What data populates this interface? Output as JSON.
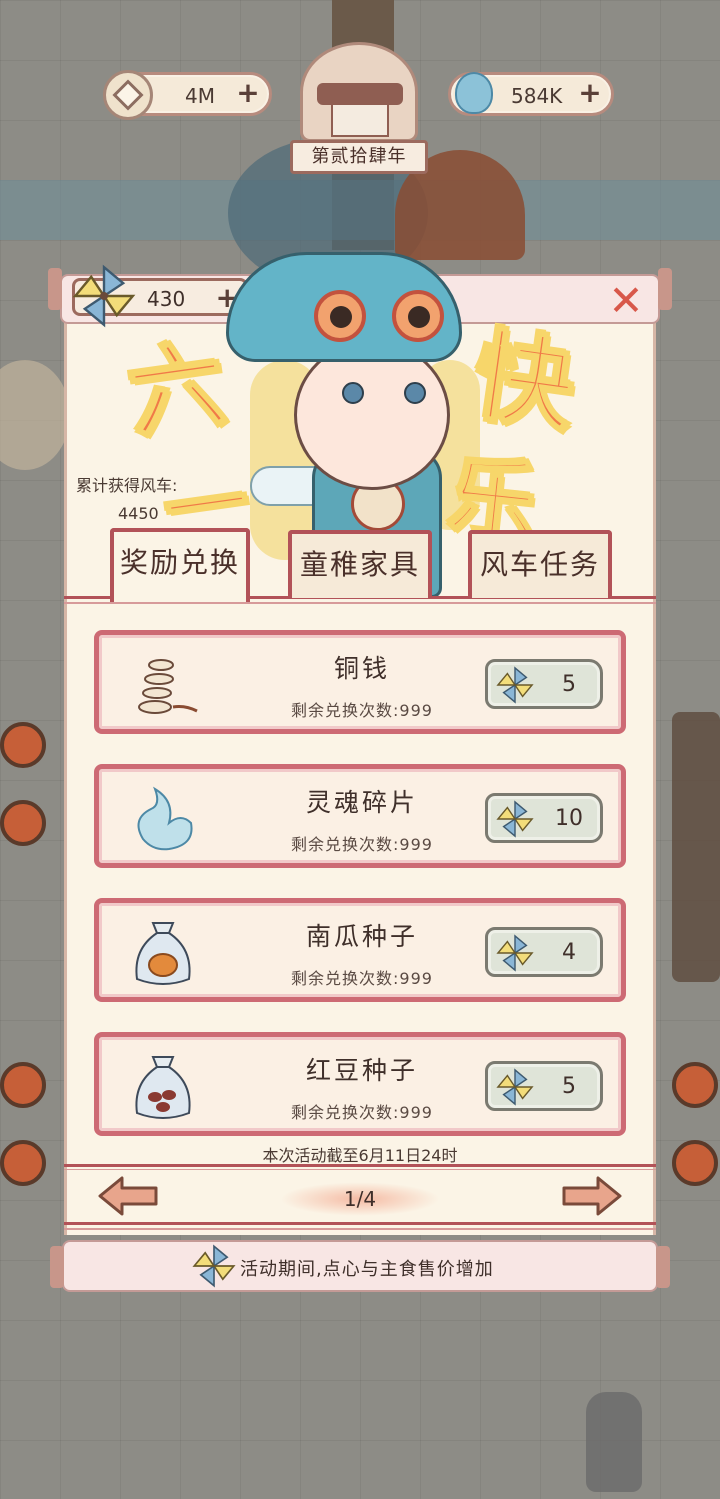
{
  "header": {
    "coins": "4M",
    "souls": "584K",
    "year_label": "第贰拾肆年"
  },
  "event": {
    "windmill_count": "430",
    "title_chars": [
      "六",
      "一",
      "快",
      "乐"
    ],
    "cumulative_label": "累计获得风车:",
    "cumulative_value": "4450"
  },
  "tabs": [
    {
      "label": "奖励兑换",
      "active": true
    },
    {
      "label": "童稚家具",
      "active": false
    },
    {
      "label": "风车任务",
      "active": false
    }
  ],
  "items": [
    {
      "name": "铜钱",
      "remaining": "剩余兑换次数:999",
      "cost": "5",
      "icon": "coin-string-icon"
    },
    {
      "name": "灵魂碎片",
      "remaining": "剩余兑换次数:999",
      "cost": "10",
      "icon": "soul-fragment-icon"
    },
    {
      "name": "南瓜种子",
      "remaining": "剩余兑换次数:999",
      "cost": "4",
      "icon": "pumpkin-seed-bag-icon"
    },
    {
      "name": "红豆种子",
      "remaining": "剩余兑换次数:999",
      "cost": "5",
      "icon": "red-bean-seed-bag-icon"
    }
  ],
  "footer": {
    "deadline": "本次活动截至6月11日24时",
    "page": "1/4",
    "notice": "活动期间,点心与主食售价增加"
  },
  "colors": {
    "accent_red": "#cd6a74",
    "tab_border": "#b25258",
    "paper": "#fbf4e6",
    "title_orange": "#f07a48"
  }
}
